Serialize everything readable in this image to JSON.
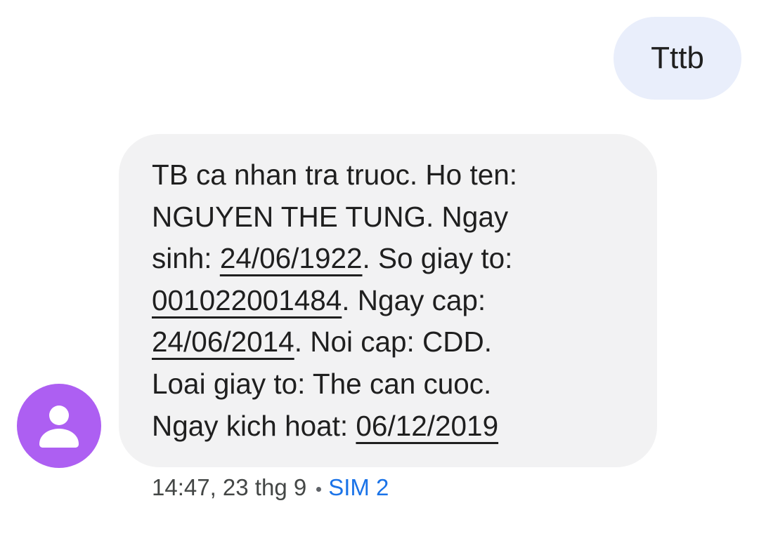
{
  "outgoing_message": {
    "text": "Tttb"
  },
  "incoming_message": {
    "line1": "TB ca nhan tra truoc. Ho ten:",
    "line2": "NGUYEN THE TUNG. Ngay",
    "line3_prefix": "sinh: ",
    "birth_date": "24/06/1922",
    "line3_suffix": ". So giay to:",
    "id_number": "001022001484",
    "line4_suffix": ". Ngay cap:",
    "issue_date": "24/06/2014",
    "line5_suffix": ". Noi cap: CDD.",
    "line6": "Loai giay to: The can cuoc.",
    "line7_prefix": "Ngay kich hoat: ",
    "activation_date": "06/12/2019"
  },
  "sender": {
    "avatar_icon": "person-icon",
    "avatar_color": "#ad5ff2"
  },
  "message_meta": {
    "timestamp": "14:47, 23 thg 9",
    "sim": "SIM 2"
  },
  "colors": {
    "outgoing_bubble": "#e9eefb",
    "incoming_bubble": "#f2f2f3",
    "sim_label": "#1a73e8"
  }
}
